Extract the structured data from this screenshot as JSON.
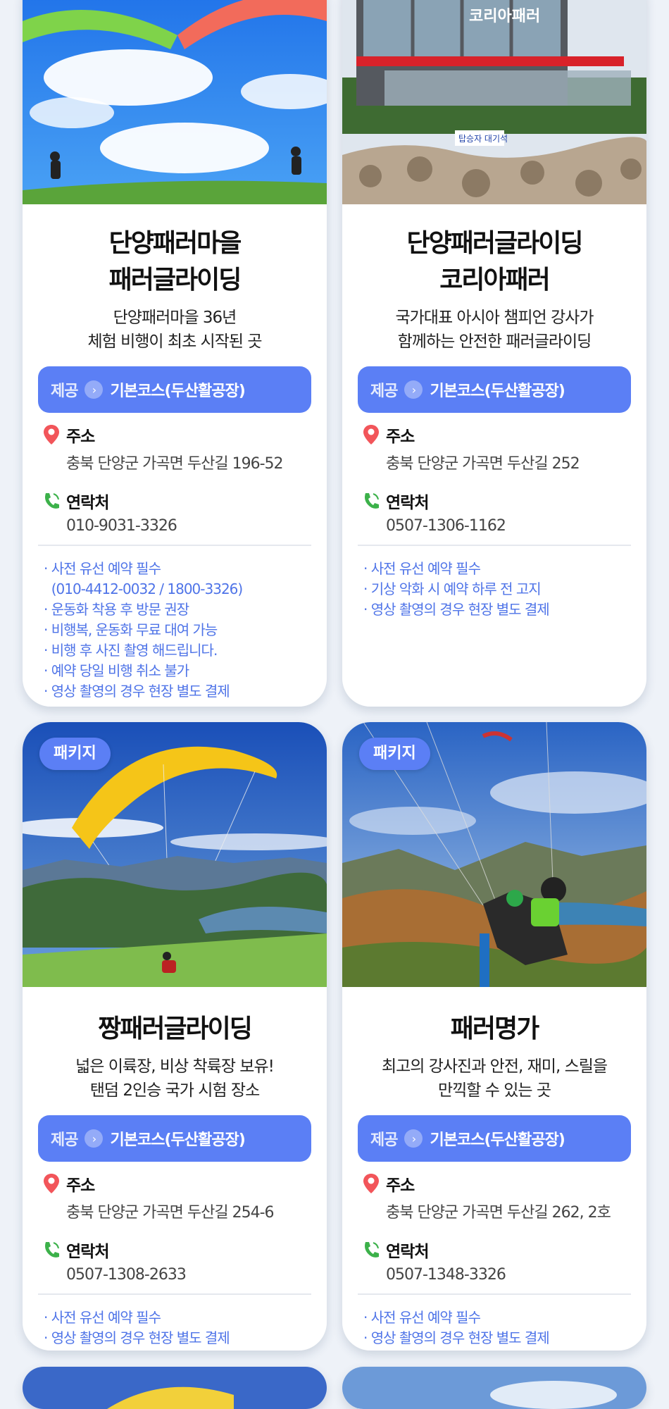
{
  "provide_label": "제공",
  "address_label": "주소",
  "contact_label": "연락처",
  "cards": [
    {
      "title": "단양패러마을\n패러글라이딩",
      "subtitle": "단양패러마을 36년\n체험 비행이 최초 시작된 곳",
      "course": "기본코스(두산활공장)",
      "address": "충북 단양군 가곡면 두산길 196-52",
      "phone": "010-9031-3326",
      "notes": [
        "· 사전 유선 예약 필수",
        "  (010-4412-0032 / 1800-3326)",
        "· 운동화 착용 후 방문 권장",
        "· 비행복, 운동화 무료 대여 가능",
        "· 비행 후 사진 촬영 해드립니다.",
        "· 예약 당일 비행 취소 불가",
        "· 영상 촬영의 경우 현장 별도 결제"
      ]
    },
    {
      "title": "단양패러글라이딩\n코리아패러",
      "subtitle": "국가대표 아시아 챔피언 강사가\n함께하는 안전한 패러글라이딩",
      "course": "기본코스(두산활공장)",
      "address": "충북 단양군 가곡면 두산길 252",
      "phone": "0507-1306-1162",
      "notes": [
        "· 사전 유선 예약 필수",
        "· 기상 악화 시 예약 하루 전 고지",
        "· 영상 촬영의 경우 현장 별도 결제"
      ]
    },
    {
      "badge": "패키지",
      "title": "짱패러글라이딩",
      "subtitle": "넓은 이륙장, 비상 착륙장 보유!\n탠덤 2인승 국가 시험 장소",
      "course": "기본코스(두산활공장)",
      "address": "충북 단양군 가곡면 두산길 254-6",
      "phone": "0507-1308-2633",
      "notes": [
        "· 사전 유선 예약 필수",
        "· 영상 촬영의 경우 현장 별도 결제"
      ]
    },
    {
      "badge": "패키지",
      "title": "패러명가",
      "subtitle": "최고의 강사진과 안전, 재미, 스릴을\n만끽할 수 있는 곳",
      "course": "기본코스(두산활공장)",
      "address": "충북 단양군 가곡면 두산길 262, 2호",
      "phone": "0507-1348-3326",
      "notes": [
        "· 사전 유선 예약 필수",
        "· 영상 촬영의 경우 현장 별도 결제"
      ]
    }
  ],
  "building_sign": "코리아패러",
  "building_banner": "탑승자 대기석"
}
